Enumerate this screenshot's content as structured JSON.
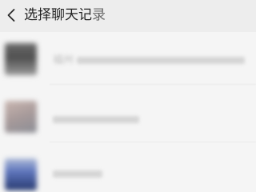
{
  "header": {
    "title": "选择聊天记",
    "title_tail": "录",
    "back_icon": "chevron-left-icon"
  },
  "chats": [
    {
      "label": "福州",
      "avatar_colors": [
        "#545454",
        "#8a8a8a"
      ]
    },
    {
      "label": "",
      "avatar_colors": [
        "#b9a7a1",
        "#8d8e95"
      ]
    },
    {
      "label": "",
      "avatar_colors": [
        "#5a70b8",
        "#2a3a6d"
      ]
    }
  ]
}
